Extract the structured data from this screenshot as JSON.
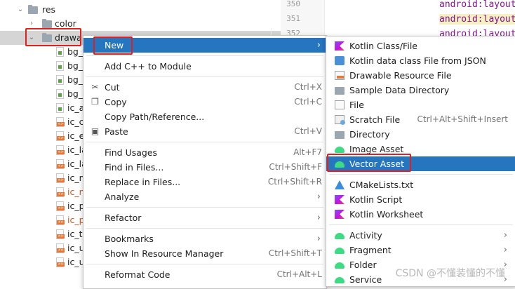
{
  "tree": {
    "items": [
      {
        "label": "res",
        "kind": "folder",
        "indent": 0,
        "expanded": true
      },
      {
        "label": "color",
        "kind": "folder",
        "indent": 1,
        "expanded": false
      },
      {
        "label": "drawa",
        "kind": "folder",
        "indent": 1,
        "expanded": true,
        "selected": true
      },
      {
        "label": "bg_",
        "kind": "xml-green"
      },
      {
        "label": "bg_",
        "kind": "xml-green"
      },
      {
        "label": "bg_",
        "kind": "xml-green"
      },
      {
        "label": "bg_",
        "kind": "xml-green"
      },
      {
        "label": "ic_a",
        "kind": "xml-green"
      },
      {
        "label": "ic_c",
        "kind": "xml-orange"
      },
      {
        "label": "ic_e",
        "kind": "xml-orange"
      },
      {
        "label": "ic_la",
        "kind": "xml-orange"
      },
      {
        "label": "ic_la",
        "kind": "xml-orange"
      },
      {
        "label": "ic_m",
        "kind": "xml-orange"
      },
      {
        "label": "ic_n",
        "kind": "xml-orange",
        "red": true
      },
      {
        "label": "ic_p",
        "kind": "xml-orange"
      },
      {
        "label": "ic_p",
        "kind": "xml-orange",
        "red": true
      },
      {
        "label": "ic_ti",
        "kind": "xml-orange"
      },
      {
        "label": "ic_u",
        "kind": "xml-orange"
      },
      {
        "label": "ic_u",
        "kind": "xml-orange"
      }
    ]
  },
  "editor": {
    "line_numbers": [
      "350",
      "351",
      "352"
    ],
    "code_lines": [
      {
        "text": "android:layout",
        "highlight": false
      },
      {
        "text": "android:layout",
        "highlight": true
      },
      {
        "text": "android:layout",
        "highlight": false
      }
    ]
  },
  "context_menu": {
    "items": [
      {
        "type": "item",
        "label": "New",
        "active": true,
        "arrow": true
      },
      {
        "type": "sep"
      },
      {
        "type": "item",
        "label": "Add C++ to Module"
      },
      {
        "type": "sep"
      },
      {
        "type": "item",
        "label": "Cut",
        "shortcut": "Ctrl+X",
        "icon": "scissors-icon",
        "glyph": "✂"
      },
      {
        "type": "item",
        "label": "Copy",
        "shortcut": "Ctrl+C",
        "icon": "copy-icon",
        "glyph": "❐"
      },
      {
        "type": "item",
        "label": "Copy Path/Reference..."
      },
      {
        "type": "item",
        "label": "Paste",
        "shortcut": "Ctrl+V",
        "icon": "paste-icon",
        "glyph": "▣"
      },
      {
        "type": "sep"
      },
      {
        "type": "item",
        "label": "Find Usages",
        "shortcut": "Alt+F7"
      },
      {
        "type": "item",
        "label": "Find in Files...",
        "shortcut": "Ctrl+Shift+F"
      },
      {
        "type": "item",
        "label": "Replace in Files...",
        "shortcut": "Ctrl+Shift+R"
      },
      {
        "type": "item",
        "label": "Analyze",
        "arrow": true
      },
      {
        "type": "sep"
      },
      {
        "type": "item",
        "label": "Refactor",
        "arrow": true
      },
      {
        "type": "sep"
      },
      {
        "type": "item",
        "label": "Bookmarks",
        "arrow": true
      },
      {
        "type": "item",
        "label": "Show In Resource Manager",
        "shortcut": "Ctrl+Shift+T"
      },
      {
        "type": "sep"
      },
      {
        "type": "item",
        "label": "Reformat Code",
        "shortcut": "Ctrl+Alt+L"
      }
    ]
  },
  "submenu": {
    "items": [
      {
        "type": "item",
        "label": "Kotlin Class/File",
        "icon": "kotlin"
      },
      {
        "type": "item",
        "label": "Kotlin data class File from JSON",
        "icon": "json"
      },
      {
        "type": "item",
        "label": "Drawable Resource File",
        "icon": "drawable"
      },
      {
        "type": "item",
        "label": "Sample Data Directory",
        "icon": "folder"
      },
      {
        "type": "item",
        "label": "File",
        "icon": "doc"
      },
      {
        "type": "item",
        "label": "Scratch File",
        "icon": "scratch",
        "shortcut": "Ctrl+Alt+Shift+Insert"
      },
      {
        "type": "item",
        "label": "Directory",
        "icon": "folder"
      },
      {
        "type": "item",
        "label": "Image Asset",
        "icon": "android"
      },
      {
        "type": "item",
        "label": "Vector Asset",
        "icon": "android",
        "active": true
      },
      {
        "type": "sep"
      },
      {
        "type": "item",
        "label": "CMakeLists.txt",
        "icon": "cmake"
      },
      {
        "type": "item",
        "label": "Kotlin Script",
        "icon": "kotlin"
      },
      {
        "type": "item",
        "label": "Kotlin Worksheet",
        "icon": "kotlin"
      },
      {
        "type": "sep"
      },
      {
        "type": "item",
        "label": "Activity",
        "icon": "android",
        "arrow": true
      },
      {
        "type": "item",
        "label": "Fragment",
        "icon": "android",
        "arrow": true
      },
      {
        "type": "item",
        "label": "Folder",
        "icon": "android",
        "arrow": true
      },
      {
        "type": "item",
        "label": "Service",
        "icon": "android",
        "arrow": true
      }
    ]
  },
  "watermark": "CSDN @不懂装懂的不懂",
  "colors": {
    "accent": "#2675bf",
    "annotation": "#e02020"
  }
}
